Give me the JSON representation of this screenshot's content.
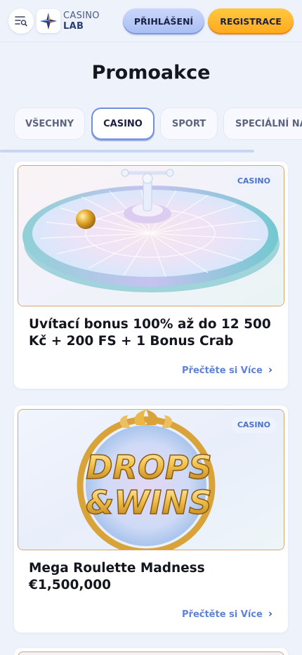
{
  "header": {
    "logo_line1": "CASINO",
    "logo_line2": "LAB",
    "login_label": "PŘIHLÁŠENÍ",
    "register_label": "REGISTRACE"
  },
  "page": {
    "title": "Promoakce"
  },
  "tabs": [
    {
      "label": "VŠECHNY",
      "active": false
    },
    {
      "label": "CASINO",
      "active": true
    },
    {
      "label": "SPORT",
      "active": false
    },
    {
      "label": "SPECIÁLNÍ NA",
      "active": false
    }
  ],
  "promos": [
    {
      "badge": "CASINO",
      "title": "Uvítací bonus 100% až do 12 500 Kč + 200 FS + 1 Bonus Crab",
      "read_more": "Přečtěte si Více",
      "image_icon": "roulette-wheel"
    },
    {
      "badge": "CASINO",
      "title": "Mega Roulette Madness €1,500,000",
      "read_more": "Přečtěte si Více",
      "image_icon": "drops-and-wins-logo",
      "image_text_line1": "DROPS",
      "image_text_line2": "&WINS"
    }
  ],
  "colors": {
    "background": "#eef2fb",
    "accent_blue": "#5d82d6",
    "register_orange": "#ffb52a",
    "login_blue": "#b8c9f7"
  }
}
